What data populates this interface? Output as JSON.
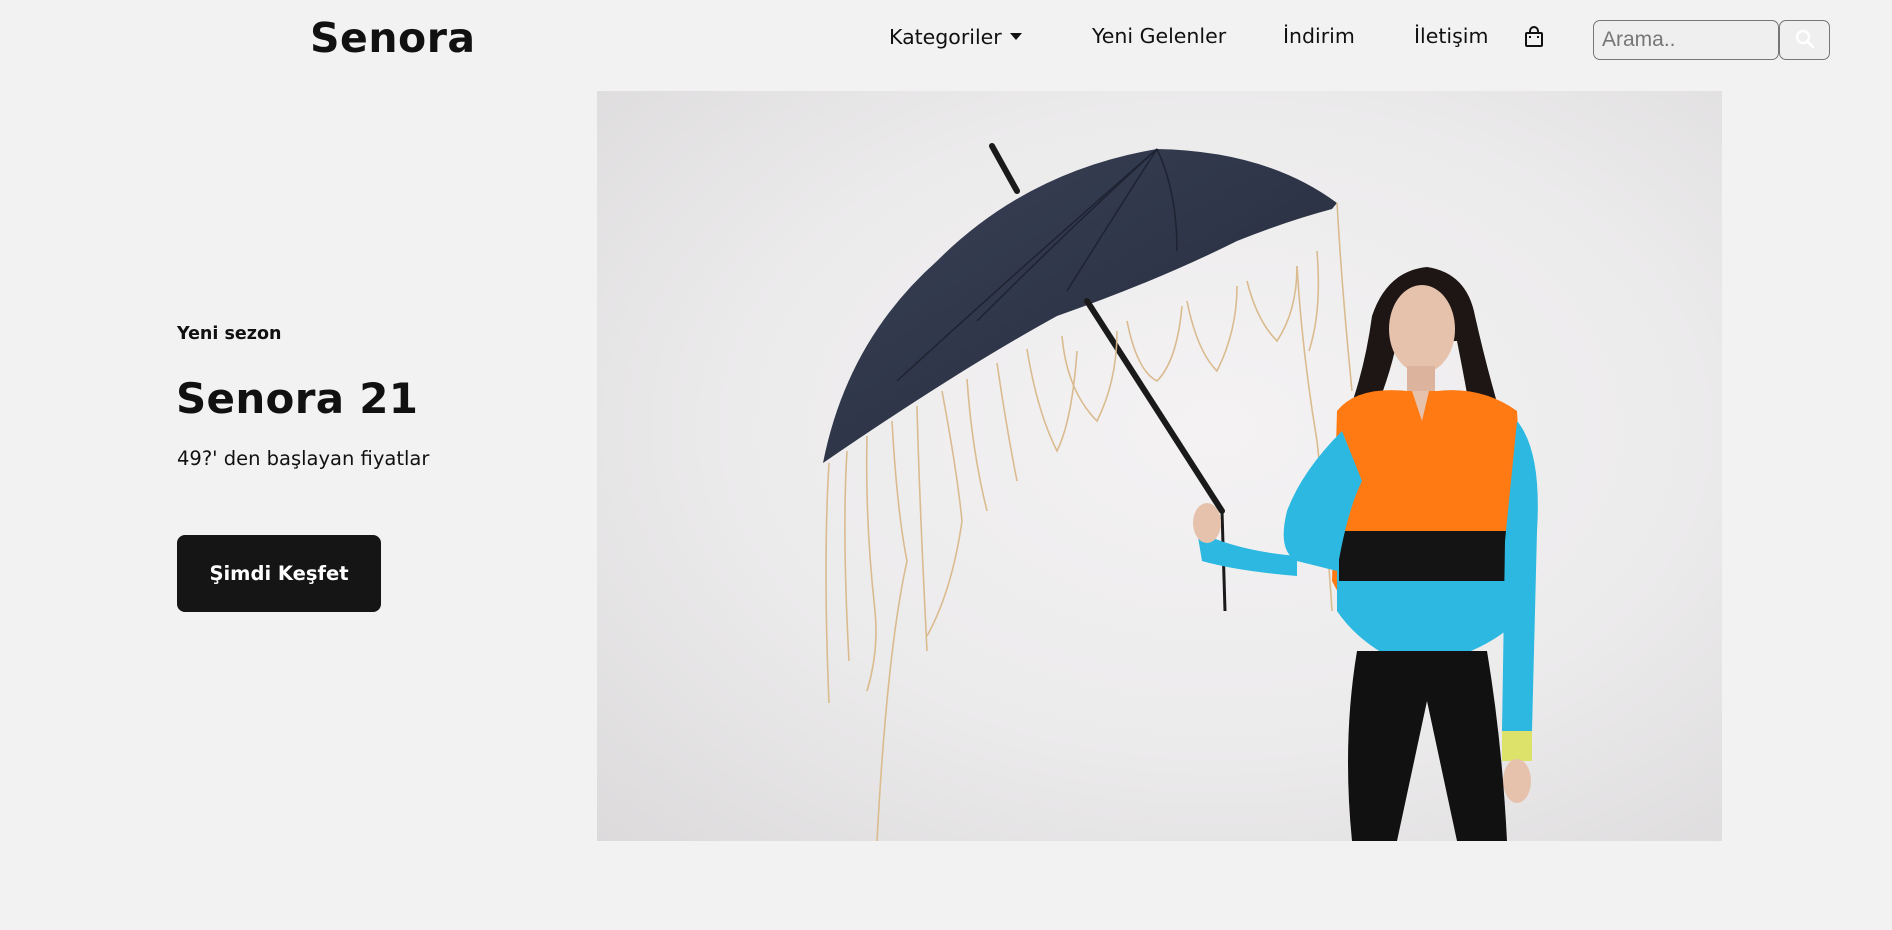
{
  "header": {
    "logo": "Senora",
    "nav": {
      "categories": "Kategoriler",
      "new_arrivals": "Yeni Gelenler",
      "sale": "İndirim",
      "contact": "İletişim"
    },
    "cart_icon": "shopping-bag-icon",
    "search": {
      "placeholder": "Arama..",
      "value": "",
      "button_icon": "search-icon"
    }
  },
  "hero": {
    "eyebrow": "Yeni sezon",
    "title": "Senora 21",
    "subtitle": "49?' den başlayan fiyatlar",
    "cta_label": "Şimdi Keşfet",
    "image_subject": "model-with-fringed-umbrella"
  },
  "colors": {
    "background": "#f2f2f2",
    "text": "#111111",
    "cta_background": "#151515",
    "cta_text": "#ffffff",
    "umbrella": "#2d3448",
    "top_orange": "#ff7a12",
    "top_blue": "#2cb8e0",
    "top_yellow": "#dde26a"
  }
}
